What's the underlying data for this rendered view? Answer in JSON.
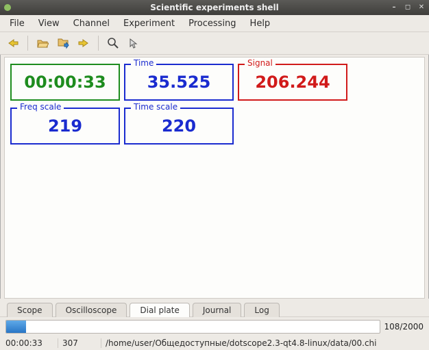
{
  "window": {
    "title": "Scientific experiments shell"
  },
  "menus": [
    "File",
    "View",
    "Channel",
    "Experiment",
    "Processing",
    "Help"
  ],
  "toolbar_icons": [
    "back",
    "open",
    "save-copy",
    "forward",
    "zoom",
    "pointer"
  ],
  "dials": {
    "clock": {
      "label": "",
      "value": "00:00:33",
      "color": "green"
    },
    "time": {
      "label": "Time",
      "value": "35.525",
      "color": "blue"
    },
    "signal": {
      "label": "Signal",
      "value": "206.244",
      "color": "red"
    },
    "freq_scale": {
      "label": "Freq scale",
      "value": "219",
      "color": "blue"
    },
    "time_scale": {
      "label": "Time scale",
      "value": "220",
      "color": "blue"
    }
  },
  "tabs": {
    "items": [
      "Scope",
      "Oscilloscope",
      "Dial plate",
      "Journal",
      "Log"
    ],
    "active_index": 2
  },
  "progress": {
    "current": 108,
    "total": 2000,
    "label": "108/2000"
  },
  "status": {
    "clock": "00:00:33",
    "index": "307",
    "path": "/home/user/Общедоступные/dotscope2.3-qt4.8-linux/data/00.chi"
  }
}
